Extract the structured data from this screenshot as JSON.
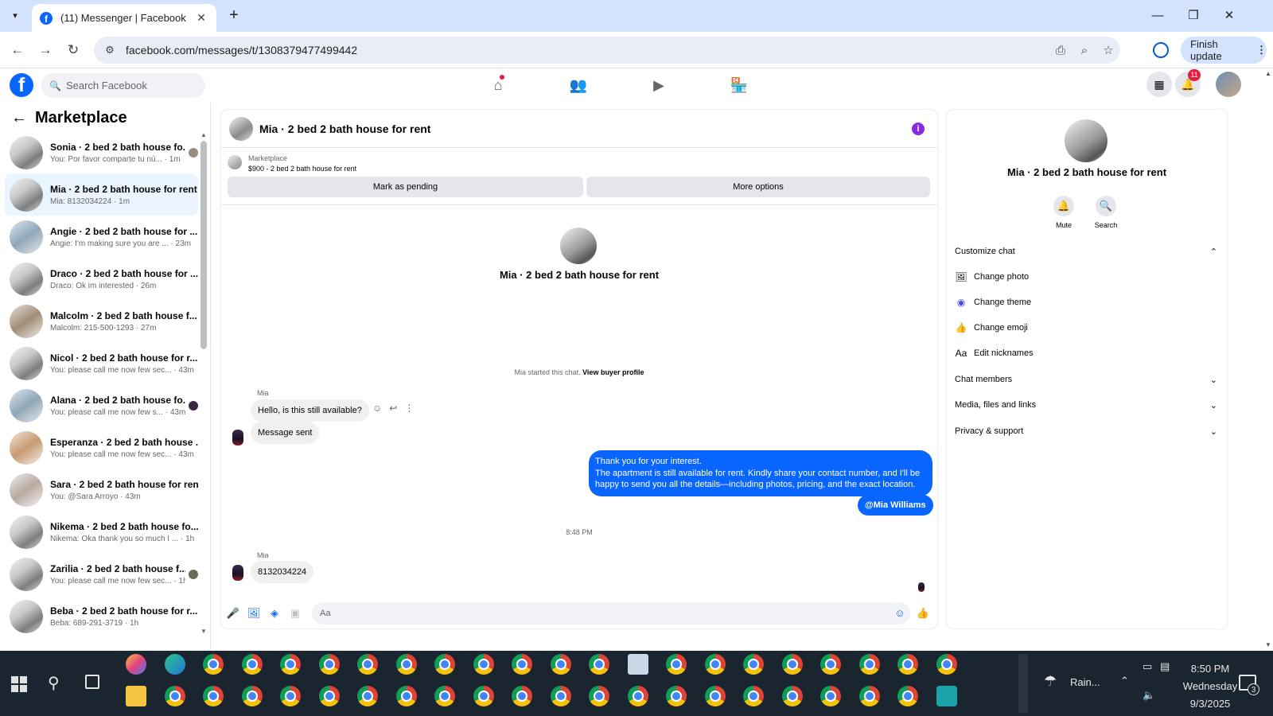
{
  "browser": {
    "tab_title": "(11) Messenger | Facebook",
    "url": "facebook.com/messages/t/1308379477499442",
    "finish_update_label": "Finish update"
  },
  "fb": {
    "logo_letter": "f",
    "search_placeholder": "Search Facebook",
    "notification_count": "11"
  },
  "sidebar": {
    "title": "Marketplace",
    "conversations": [
      {
        "name": "Sonia · 2 bed 2 bath house fo...",
        "snippet": "You: Por favor comparte tu nú... · 1m",
        "active": false
      },
      {
        "name": "Mia · 2 bed 2 bath house for rent",
        "snippet": "Mia: 8132034224 · 1m",
        "active": true
      },
      {
        "name": "Angie · 2 bed 2 bath house for ...",
        "snippet": "Angie: I'm making sure you are ... · 23m",
        "active": false
      },
      {
        "name": "Draco · 2 bed 2 bath house for ...",
        "snippet": "Draco: Ok im interested · 26m",
        "active": false
      },
      {
        "name": "Malcolm · 2 bed 2 bath house f...",
        "snippet": "Malcolm: 215-500-1293 · 27m",
        "active": false
      },
      {
        "name": "Nicol · 2 bed 2 bath house for r...",
        "snippet": "You: please call me now few sec... · 43m",
        "active": false
      },
      {
        "name": "Alana · 2 bed 2 bath house fo...",
        "snippet": "You: please call me now few s... · 43m",
        "active": false
      },
      {
        "name": "Esperanza · 2 bed 2 bath house ...",
        "snippet": "You: please call me now few sec... · 43m",
        "active": false
      },
      {
        "name": "Sara · 2 bed 2 bath house for rent",
        "snippet": "You: @Sara Arroyo · 43m",
        "active": false
      },
      {
        "name": "Nikema · 2 bed 2 bath house fo...",
        "snippet": "Nikema: Oka thank you so much I ... · 1h",
        "active": false
      },
      {
        "name": "Zarilia · 2 bed 2 bath house f...",
        "snippet": "You: please call me now few sec... · 1h",
        "active": false
      },
      {
        "name": "Beba · 2 bed 2 bath house for r...",
        "snippet": "Beba: 689-291-3719 · 1h",
        "active": false
      }
    ]
  },
  "chat": {
    "title": "Mia · 2 bed 2 bath house for rent",
    "marketplace_label": "Marketplace",
    "listing": "$900 - 2 bed 2 bath house for rent",
    "mark_pending_label": "Mark as pending",
    "more_options_label": "More options",
    "intro_title": "Mia · 2 bed 2 bath house for rent",
    "started_text": "Mia started this chat.",
    "view_buyer_label": "View buyer profile",
    "sender_1": "Mia",
    "msg_1": "Hello, is this still available?",
    "msg_2": "Message sent",
    "reply_line_1": "Thank you for your interest.",
    "reply_line_2": "The apartment is still available for rent. Kindly share your contact number, and I'll be happy to send you all the details—including photos, pricing, and the exact location.",
    "mention": "@Mia Williams",
    "timestamp": "8:48 PM",
    "sender_2": "Mia",
    "msg_3": "8132034224",
    "composer_placeholder": "Aa"
  },
  "panel": {
    "title": "Mia · 2 bed 2 bath house for rent",
    "mute_label": "Mute",
    "search_label": "Search",
    "customize_label": "Customize chat",
    "change_photo": "Change photo",
    "change_theme": "Change theme",
    "change_emoji": "Change emoji",
    "edit_nicknames": "Edit nicknames",
    "chat_members": "Chat members",
    "media_files": "Media, files and links",
    "privacy_support": "Privacy & support",
    "nickname_icon_text": "Aa"
  },
  "taskbar": {
    "weather": "Rain...",
    "time": "8:50 PM",
    "day": "Wednesday",
    "date": "9/3/2025",
    "notification_badge": "3"
  },
  "colors": {
    "fb_blue": "#0866ff",
    "active_conv_bg": "#ebf5ff",
    "info_purple": "#8a2be2",
    "browser_chrome": "#d3e3fd",
    "taskbar_bg": "#1b2530"
  }
}
